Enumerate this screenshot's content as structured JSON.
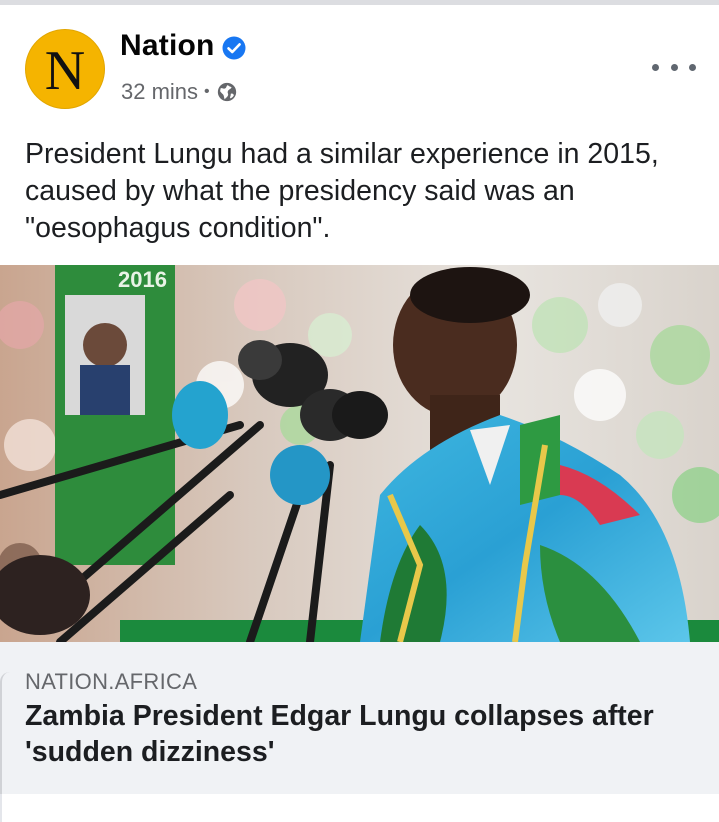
{
  "post": {
    "page_name": "Nation",
    "avatar_letter": "N",
    "time": "32 mins",
    "separator": "•",
    "audience_icon": "globe-icon",
    "verified_icon": "verified-badge-icon",
    "more_icon": "more-options-icon",
    "text": "President Lungu had a similar experience in 2015, caused by what the presidency said was an \"oesophagus condition\"."
  },
  "link_preview": {
    "domain": "NATION.AFRICA",
    "headline": "Zambia President Edgar Lungu collapses after 'sudden dizziness'"
  },
  "colors": {
    "avatar_bg": "#f5b400",
    "verified_blue": "#1877f2",
    "meta_gray": "#65676b",
    "card_bg": "#f0f2f5"
  }
}
